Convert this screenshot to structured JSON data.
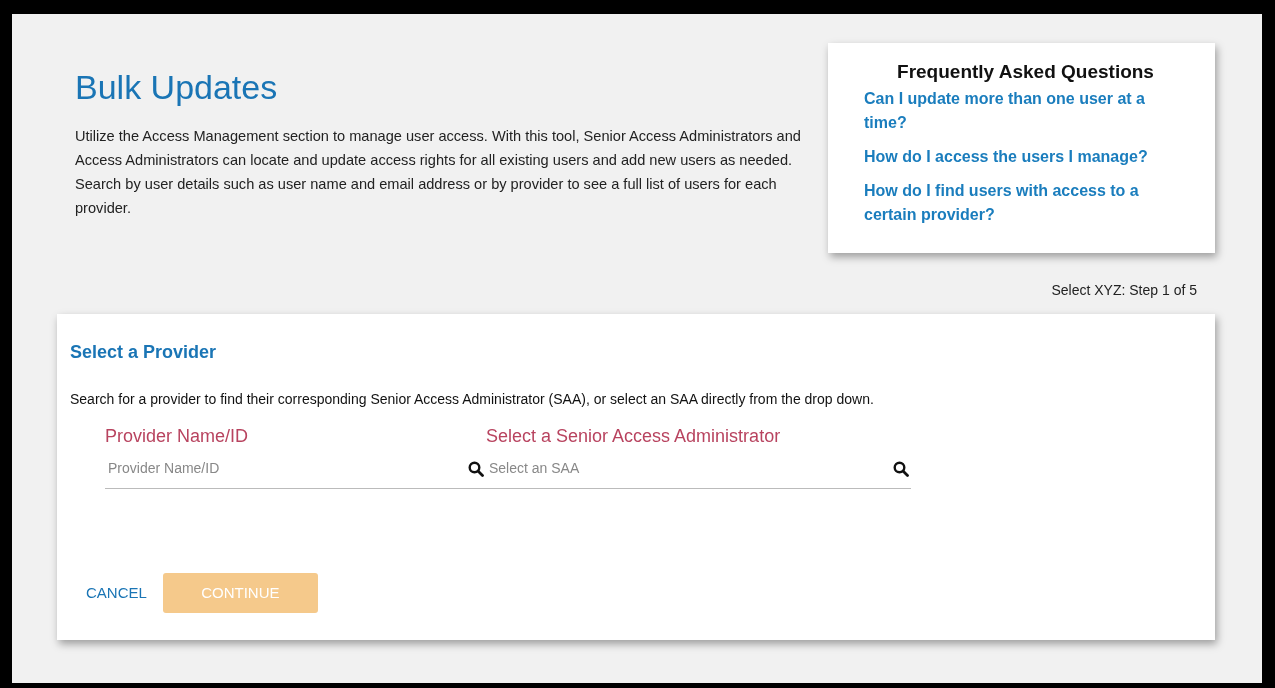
{
  "page": {
    "title": "Bulk Updates",
    "intro": "Utilize the Access Management section to manage user access. With this tool, Senior Access Administrators and Access Administrators can locate and update access rights for all existing users and add new users as needed. Search by user details such as user name and email address or by provider to see a full list of users for each provider."
  },
  "faq": {
    "title": "Frequently Asked Questions",
    "links": [
      "Can I update more than one user at a time?",
      "How do I access the users I manage?",
      "How do I find users with access to a certain provider?"
    ]
  },
  "step": "Select XYZ: Step 1 of 5",
  "form": {
    "title": "Select a Provider",
    "description": "Search for a provider to find their corresponding Senior Access Administrator (SAA), or select an SAA directly from the drop down.",
    "fields": [
      {
        "label": "Provider Name/ID",
        "placeholder": "Provider Name/ID"
      },
      {
        "label": "Select a Senior Access Administrator",
        "placeholder": "Select an SAA"
      }
    ],
    "cancel": "CANCEL",
    "continue": {
      "label": "CONTINUE",
      "disabled": true
    }
  }
}
